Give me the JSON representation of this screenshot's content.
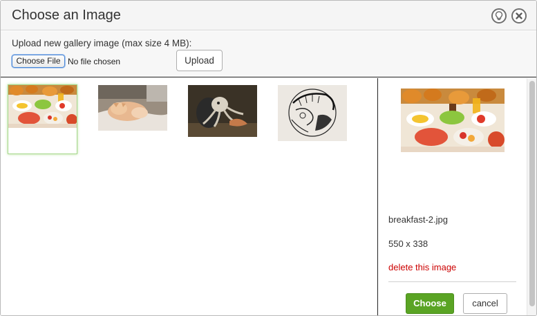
{
  "dialog": {
    "title": "Choose an Image",
    "help_icon": "lightbulb-icon",
    "close_icon": "close-icon"
  },
  "upload": {
    "label": "Upload new gallery image (max size 4 MB):",
    "file_button": "Choose File",
    "file_status": "No file chosen",
    "upload_button": "Upload"
  },
  "gallery": {
    "images": [
      {
        "subject": "breakfast",
        "selected": true
      },
      {
        "subject": "cat",
        "selected": false
      },
      {
        "subject": "octopus",
        "selected": false
      },
      {
        "subject": "ink-drawing",
        "selected": false
      }
    ]
  },
  "details": {
    "filename": "breakfast-2.jpg",
    "dimensions": "550 x 338",
    "delete_label": "delete this image",
    "choose_button": "Choose",
    "cancel_button": "cancel"
  },
  "colors": {
    "choose_button": "#5aa424",
    "delete_link": "#cc0000",
    "selected_border": "#a4d68a"
  }
}
